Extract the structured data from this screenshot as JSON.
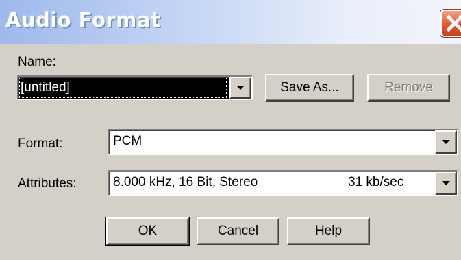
{
  "window": {
    "title": "Audio Format",
    "close_icon": "close-icon"
  },
  "name": {
    "label": "Name:",
    "value": "[untitled]",
    "save_as_label": "Save As...",
    "remove_label": "Remove",
    "remove_enabled": false
  },
  "format": {
    "label": "Format:",
    "value": "PCM"
  },
  "attributes": {
    "label": "Attributes:",
    "value": "8.000 kHz, 16 Bit, Stereo",
    "rate": "31 kb/sec"
  },
  "buttons": {
    "ok_label": "OK",
    "cancel_label": "Cancel",
    "help_label": "Help"
  },
  "colors": {
    "dialog_bg": "#d4d0c8",
    "close_button": "#e2572f"
  }
}
